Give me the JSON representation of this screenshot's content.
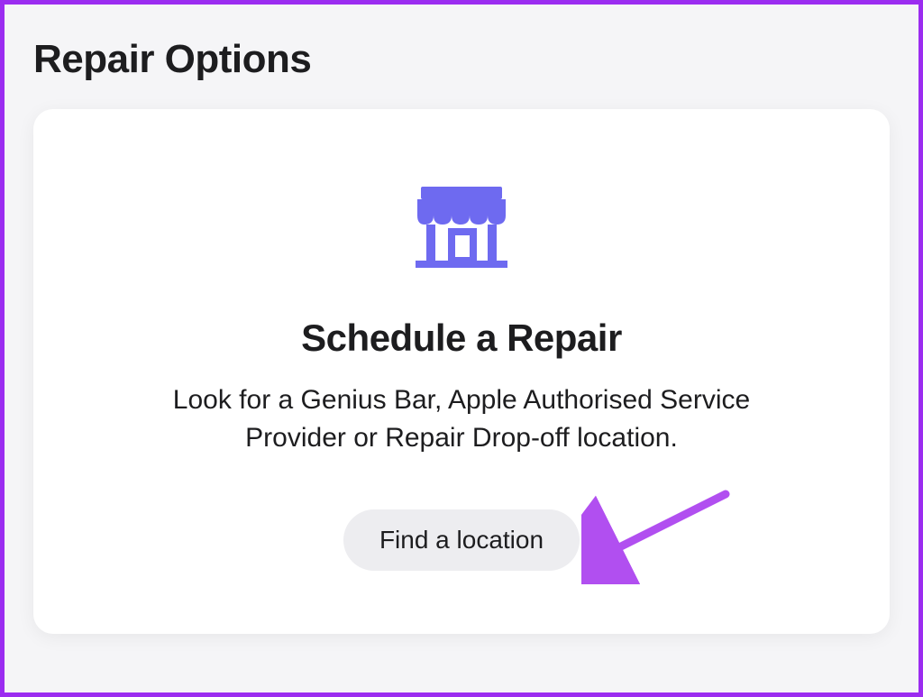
{
  "page": {
    "title": "Repair Options"
  },
  "card": {
    "icon_name": "storefront-icon",
    "title": "Schedule a Repair",
    "description": "Look for a Genius Bar, Apple Authorised Service Provider or Repair Drop-off location.",
    "button_label": "Find a location"
  },
  "colors": {
    "icon": "#6e6af0",
    "accent_border": "#9b2cf0",
    "arrow": "#b14ff0"
  }
}
